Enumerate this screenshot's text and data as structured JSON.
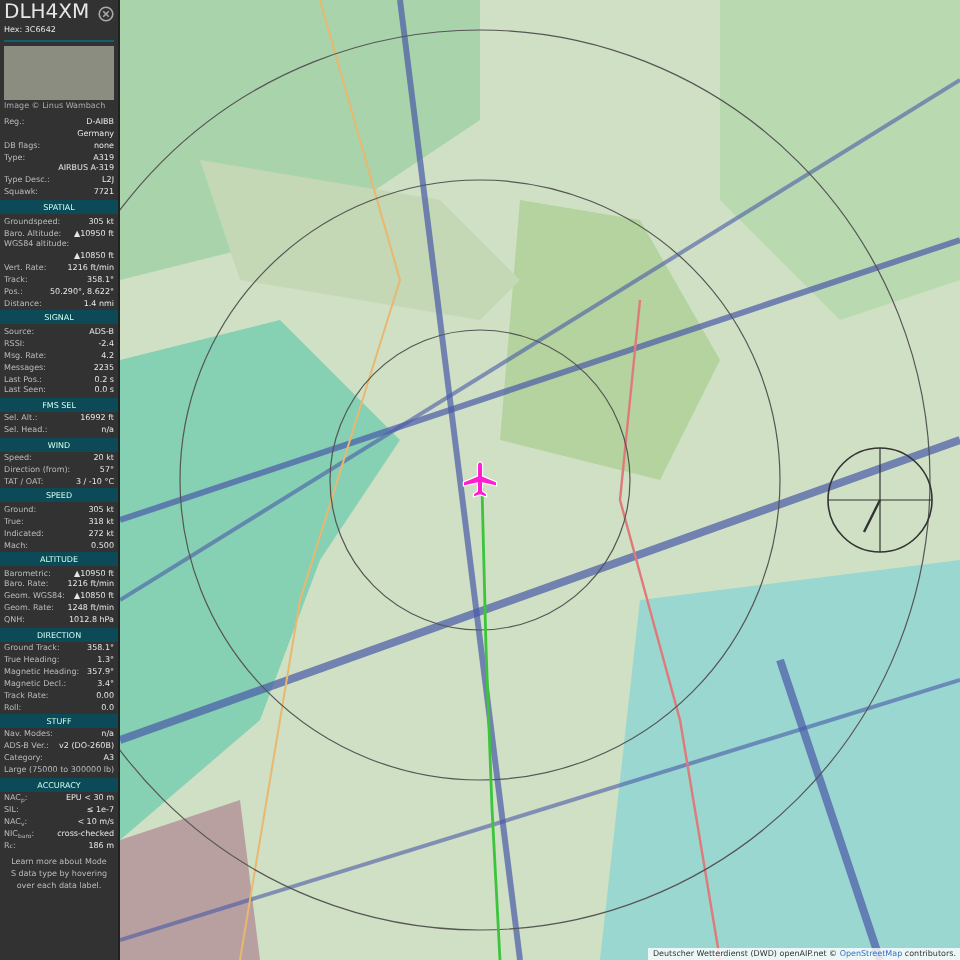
{
  "header": {
    "callsign": "DLH4XM",
    "hex": "Hex: 3C6642"
  },
  "photo": {
    "credit": "Image © Linus Wambach"
  },
  "info": [
    {
      "label": "Reg.:",
      "value": "D-AIBB"
    },
    {
      "value": "Germany"
    },
    {
      "label": "DB flags:",
      "value": "none"
    },
    {
      "label": "Type:",
      "value": "A319"
    },
    {
      "value": "AIRBUS A-319"
    },
    {
      "label": "Type Desc.:",
      "value": "L2J"
    },
    {
      "label": "Squawk:",
      "value": "7721"
    }
  ],
  "sections": [
    {
      "title": "SPATIAL",
      "rows": [
        {
          "label": "Groundspeed:",
          "value": "305 kt"
        },
        {
          "label": "Baro. Altitude:",
          "value": "▲10950 ft"
        },
        {
          "label": "WGS84 altitude:"
        },
        {
          "value": "▲10850 ft"
        },
        {
          "label": "Vert. Rate:",
          "value": "1216 ft/min"
        },
        {
          "label": "Track:",
          "value": "358.1°"
        },
        {
          "label": "Pos.:",
          "value": "50.290°, 8.622°"
        },
        {
          "label": "Distance:",
          "value": "1.4 nmi"
        }
      ]
    },
    {
      "title": "SIGNAL",
      "rows": [
        {
          "label": "Source:",
          "value": "ADS-B"
        },
        {
          "label": "RSSI:",
          "value": "-2.4"
        },
        {
          "label": "Msg. Rate:",
          "value": "4.2"
        },
        {
          "label": "Messages:",
          "value": "2235"
        },
        {
          "label": "Last Pos.:",
          "value": "0.2 s"
        },
        {
          "label": "Last Seen:",
          "value": "0.0 s"
        }
      ]
    },
    {
      "title": "FMS SEL",
      "rows": [
        {
          "label": "Sel. Alt.:",
          "value": "16992 ft"
        },
        {
          "label": "Sel. Head.:",
          "value": "n/a"
        }
      ]
    },
    {
      "title": "WIND",
      "rows": [
        {
          "label": "Speed:",
          "value": "20 kt"
        },
        {
          "label": "Direction (from):",
          "value": "57°"
        },
        {
          "label": "TAT / OAT:",
          "value": "3 / -10 °C"
        }
      ]
    },
    {
      "title": "SPEED",
      "rows": [
        {
          "label": "Ground:",
          "value": "305 kt"
        },
        {
          "label": "True:",
          "value": "318 kt"
        },
        {
          "label": "Indicated:",
          "value": "272 kt"
        },
        {
          "label": "Mach:",
          "value": "0.500"
        }
      ]
    },
    {
      "title": "ALTITUDE",
      "rows": [
        {
          "label": "Barometric:",
          "value": "▲10950 ft"
        },
        {
          "label": "Baro. Rate:",
          "value": "1216 ft/min"
        },
        {
          "label": "Geom. WGS84:",
          "value": "▲10850 ft"
        },
        {
          "label": "Geom. Rate:",
          "value": "1248 ft/min"
        },
        {
          "label": "QNH:",
          "value": "1012.8 hPa"
        }
      ]
    },
    {
      "title": "DIRECTION",
      "rows": [
        {
          "label": "Ground Track:",
          "value": "358.1°"
        },
        {
          "label": "True Heading:",
          "value": "1.3°"
        },
        {
          "label": "Magnetic Heading:",
          "value": "357.9°"
        },
        {
          "label": "Magnetic Decl.:",
          "value": "3.4°"
        },
        {
          "label": "Track Rate:",
          "value": "0.00"
        },
        {
          "label": "Roll:",
          "value": "0.0"
        }
      ]
    },
    {
      "title": "STUFF",
      "rows": [
        {
          "label": "Nav. Modes:",
          "value": "n/a"
        },
        {
          "label": "ADS-B Ver.:",
          "value": "v2 (DO-260B)"
        },
        {
          "label": "Category:",
          "value": "A3"
        },
        {
          "label": "Large (75000 to 300000 lb)"
        }
      ]
    },
    {
      "title": "ACCURACY",
      "rows": [
        {
          "label": "NAC$_{p}$:",
          "value": "EPU < 30 m"
        },
        {
          "label": "SIL:",
          "value": "≤ 1e-7"
        },
        {
          "label": "NAC$_{v}$:",
          "value": "< 10 m/s"
        },
        {
          "label": "NIC$_{baro}$:",
          "value": "cross-checked"
        },
        {
          "label": "R$_{c}$:",
          "value": "186 m"
        }
      ]
    }
  ],
  "footnote": "Learn more about Mode S data type by hovering over each data label.",
  "attribution": {
    "text": "Deutscher Wetterdienst (DWD) openAIP.net ©",
    "link": "OpenStreetMap",
    "suffix": "contributors."
  }
}
